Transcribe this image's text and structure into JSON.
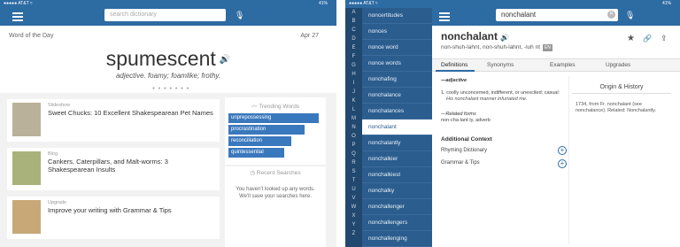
{
  "left": {
    "status": {
      "carrier": "●●●●● AT&T ≈",
      "time": "",
      "battery": "41%"
    },
    "search_placeholder": "search dictionary",
    "wotd": {
      "label": "Word of the Day",
      "date": "Apr 27",
      "word": "spumescent",
      "definition": "adjective. foamy; foamlike; frothy."
    },
    "cards": [
      {
        "kind": "Slideshow",
        "title": "Sweet Chucks: 10 Excellent Shakespearean Pet Names"
      },
      {
        "kind": "Blog",
        "title": "Cankers, Caterpillars, and Malt-worms: 3 Shakespearean Insults"
      },
      {
        "kind": "Upgrade",
        "title": "Improve your writing with Grammar & Tips"
      }
    ],
    "trending": {
      "heading": "Trending Words",
      "words": [
        {
          "word": "unprepossessing",
          "level": 1.0
        },
        {
          "word": "procrastination",
          "level": 0.84
        },
        {
          "word": "reconciliation",
          "level": 0.7
        },
        {
          "word": "quintessential",
          "level": 0.62
        }
      ]
    },
    "recent": {
      "heading": "Recent Searches",
      "message": "You haven't looked up any words. We'll save your searches here."
    }
  },
  "right": {
    "status": {
      "carrier": "●●●●● AT&T ≈",
      "battery": "41%"
    },
    "alphabet": [
      "A",
      "B",
      "C",
      "D",
      "E",
      "F",
      "G",
      "H",
      "I",
      "J",
      "K",
      "L",
      "M",
      "N",
      "O",
      "P",
      "Q",
      "R",
      "S",
      "T",
      "U",
      "V",
      "W",
      "X",
      "Y",
      "Z"
    ],
    "word_list": [
      "noncertitudes",
      "nonces",
      "nonce word",
      "nonce words",
      "nonchafing",
      "nonchalance",
      "nonchalances",
      "nonchalant",
      "nonchalantly",
      "nonchalkier",
      "nonchalkiest",
      "nonchalky",
      "nonchallenger",
      "nonchallengers",
      "nonchallenging"
    ],
    "selected_index": 7,
    "search_value": "nonchalant",
    "entry": {
      "word": "nonchalant",
      "pronunciation": "non-shuh-lahnt, non-shuh-lahnt, -luh nt",
      "lang_badge": "EN"
    },
    "tabs": [
      "Definitions",
      "Synonyms",
      "Examples",
      "Upgrades"
    ],
    "definition": {
      "pos": "—adjective",
      "sense": "1.  coolly unconcerned, indifferent, or unexcited; casual:",
      "example": "His nonchalant manner infuriated me.",
      "related_label": "—Related forms",
      "related_form": "non·cha·lant·ly, adverb"
    },
    "context": {
      "heading": "Additional Context",
      "items": [
        "Rhyming Dictionary",
        "Grammar & Tips"
      ]
    },
    "origin": {
      "heading": "Origin & History",
      "text": "1734, from Fr. nonchalant (see nonchalance). Related: Nonchalantly."
    }
  }
}
